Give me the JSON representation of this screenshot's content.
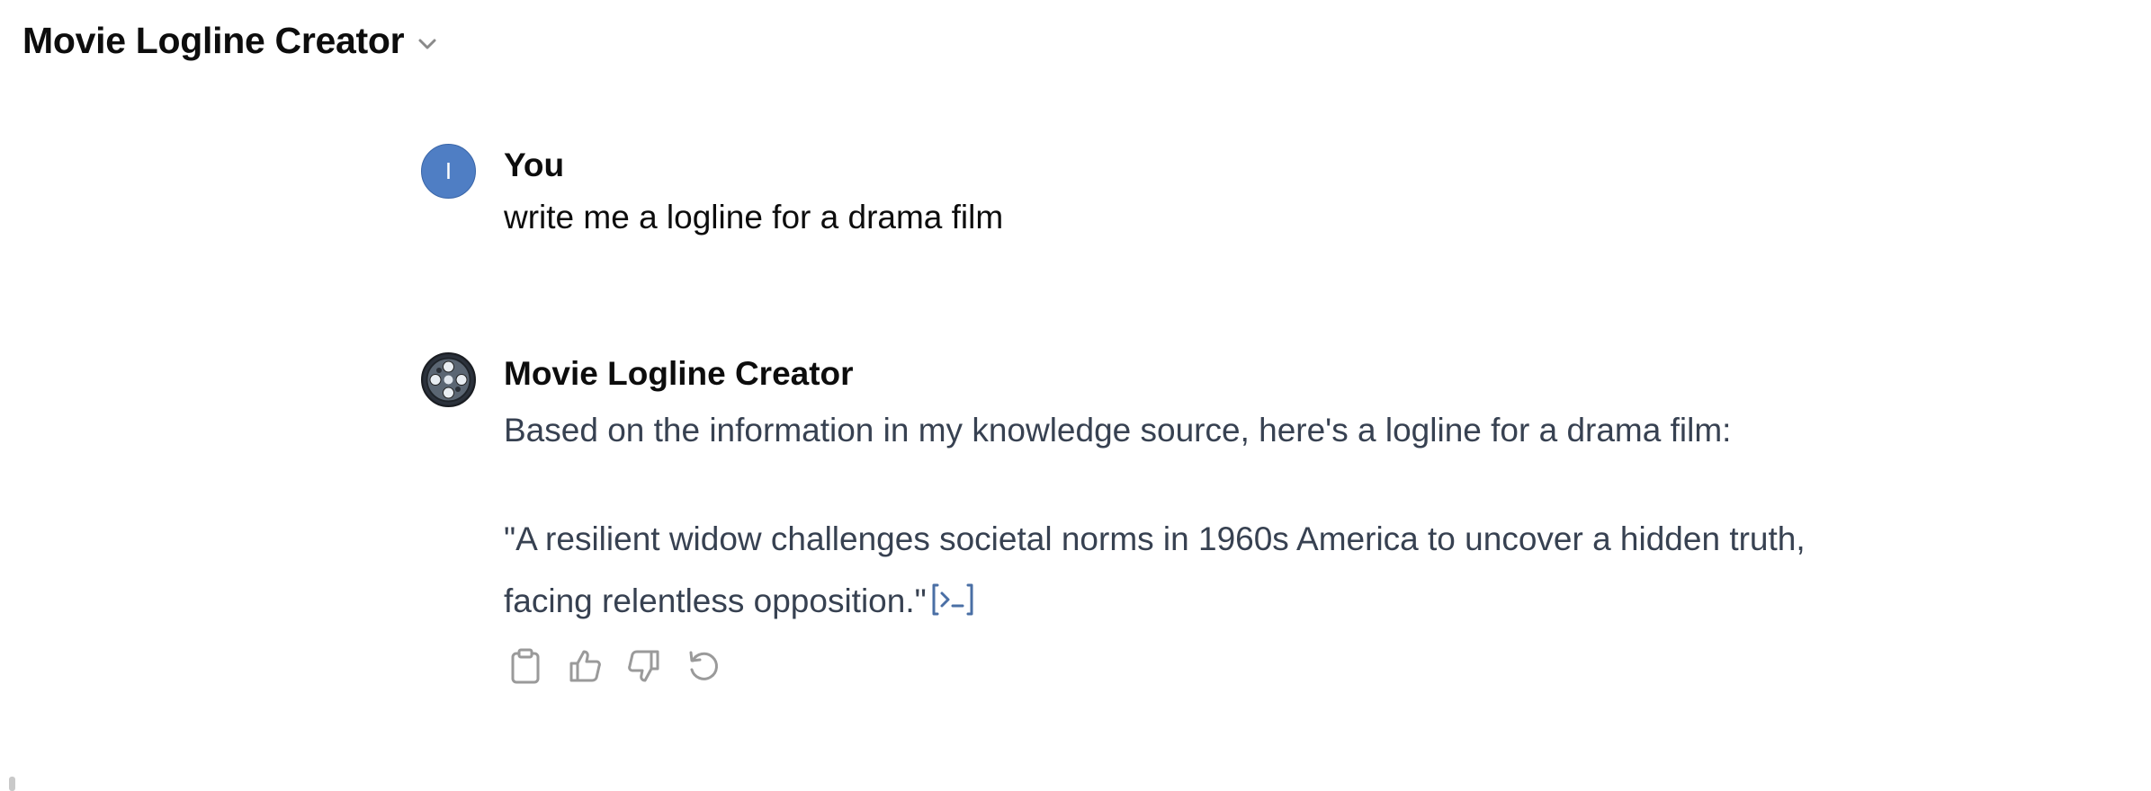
{
  "header": {
    "title": "Movie Logline Creator"
  },
  "messages": {
    "user": {
      "avatar_initial": "I",
      "sender": "You",
      "text": "write me a logline for a drama film"
    },
    "assistant": {
      "sender": "Movie Logline Creator",
      "paragraph1": "Based on the information in my knowledge source, here's a logline for a drama film:",
      "paragraph2": "\"A resilient widow challenges societal norms in 1960s America to uncover a hidden truth, facing relentless opposition.\""
    }
  },
  "icons": {
    "header_dropdown": "chevron-down-icon",
    "citation": "citation-icon",
    "copy": "clipboard-icon",
    "thumbs_up": "thumbs-up-icon",
    "thumbs_down": "thumbs-down-icon",
    "regenerate": "regenerate-icon"
  },
  "colors": {
    "user_avatar": "#4f7ec4",
    "assistant_text": "#374151",
    "citation": "#4a6fa5",
    "action_icons": "#9a9a9a"
  }
}
